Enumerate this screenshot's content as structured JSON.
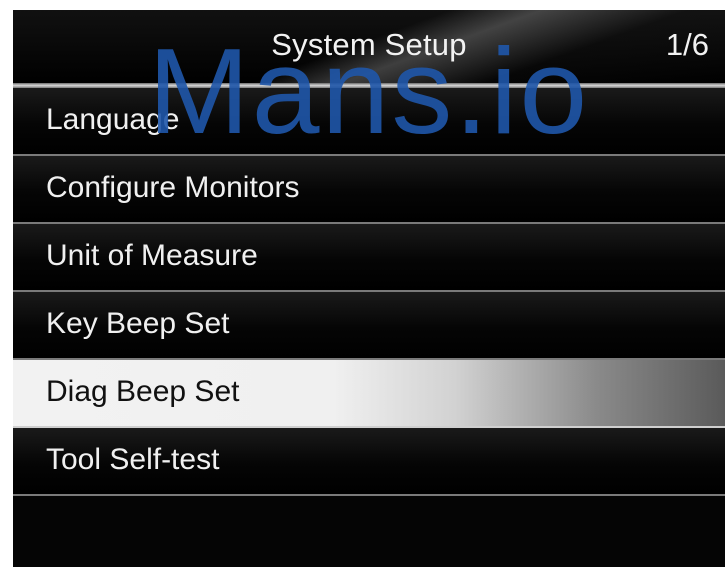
{
  "header": {
    "title": "System Setup",
    "page": "1/6"
  },
  "menu": {
    "items": [
      {
        "label": "Language",
        "selected": false
      },
      {
        "label": "Configure Monitors",
        "selected": false
      },
      {
        "label": "Unit of Measure",
        "selected": false
      },
      {
        "label": "Key Beep Set",
        "selected": false
      },
      {
        "label": "Diag Beep Set",
        "selected": true
      },
      {
        "label": "Tool Self-test",
        "selected": false
      }
    ]
  },
  "watermark": {
    "text": "Mans.io"
  },
  "colors": {
    "screen_background": "#050505",
    "header_text": "#f2f2f2",
    "item_text": "#f0f0f0",
    "selected_background": "#f0f0f0",
    "selected_text": "#111111",
    "watermark": "#1f56aa"
  }
}
